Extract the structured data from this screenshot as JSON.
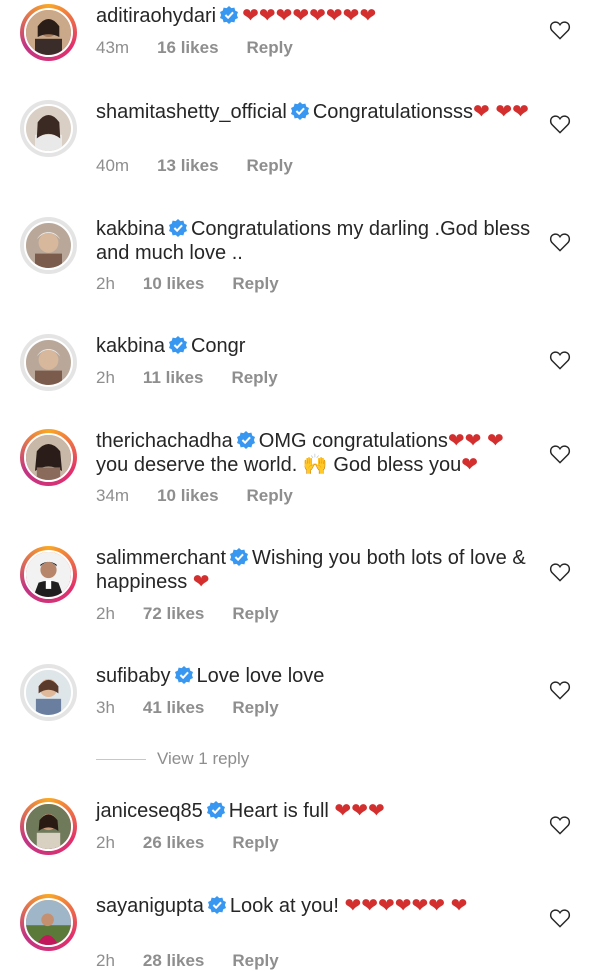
{
  "comments": [
    {
      "username": "aditirаohydari",
      "text": "❤❤❤❤❤❤❤❤",
      "time": "43m",
      "likes": "16 likes",
      "reply": "Reply"
    },
    {
      "username": "shamitashetty_official",
      "text": "Congratulationsss❤ ❤❤",
      "time": "40m",
      "likes": "13 likes",
      "reply": "Reply"
    },
    {
      "username": "kakbina",
      "text": "Congratulations my darling .God bless and much love ..",
      "time": "2h",
      "likes": "10 likes",
      "reply": "Reply"
    },
    {
      "username": "kakbina",
      "text": "Congr",
      "time": "2h",
      "likes": "11 likes",
      "reply": "Reply"
    },
    {
      "username": "therichachadha",
      "text": "OMG congratulations❤❤ ❤ you deserve the world. 🙌 God bless you❤",
      "time": "34m",
      "likes": "10 likes",
      "reply": "Reply"
    },
    {
      "username": "salimmerchant",
      "text": "Wishing you both lots of love & happiness ❤",
      "time": "2h",
      "likes": "72 likes",
      "reply": "Reply"
    },
    {
      "username": "sufibaby",
      "text": "Love love love",
      "time": "3h",
      "likes": "41 likes",
      "reply": "Reply"
    },
    {
      "username": "janiceseq85",
      "text": "Heart is full ❤❤❤",
      "time": "2h",
      "likes": "26 likes",
      "reply": "Reply"
    },
    {
      "username": "sayanigupta",
      "text": "Look at you! ❤❤❤❤❤❤ ❤",
      "time": "2h",
      "likes": "28 likes",
      "reply": "Reply"
    }
  ],
  "view_replies": "View 1 reply",
  "icons": {
    "verified": "verified-badge-icon",
    "like": "heart-outline-icon"
  },
  "colors": {
    "verified": "#3897f0",
    "heart": "#d32f2f",
    "meta": "#8e8e8e",
    "text": "#262626"
  }
}
